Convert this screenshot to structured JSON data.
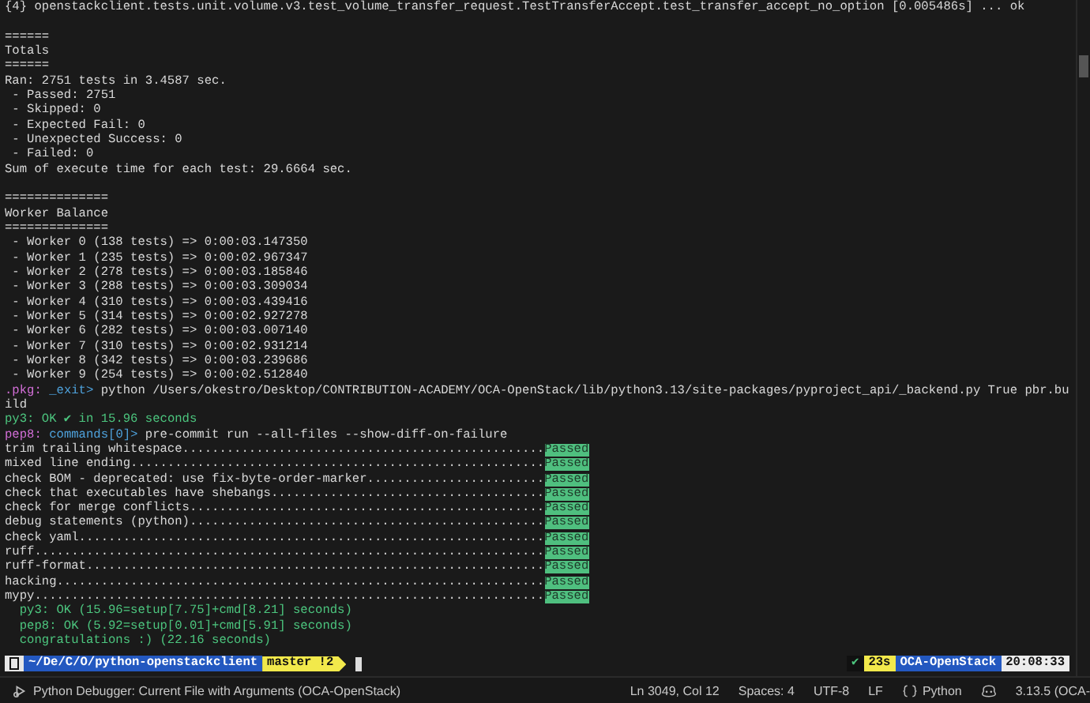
{
  "terminal": {
    "blocks": [
      [
        {
          "segments": [
            {
              "text": "{4} openstackclient.tests.unit.volume.v3.test_volume_transfer_request.TestTransferAccept.test_transfer_accept_no_option [0.005486s] ... ok",
              "kind": "plain"
            }
          ]
        }
      ],
      [
        {
          "segments": [
            {
              "text": "======",
              "kind": "plain"
            }
          ]
        },
        {
          "segments": [
            {
              "text": "Totals",
              "kind": "plain"
            }
          ]
        },
        {
          "segments": [
            {
              "text": "======",
              "kind": "plain"
            }
          ]
        },
        {
          "segments": [
            {
              "text": "Ran: 2751 tests in 3.4587 sec.",
              "kind": "plain"
            }
          ]
        },
        {
          "segments": [
            {
              "text": " - Passed: 2751",
              "kind": "plain"
            }
          ]
        },
        {
          "segments": [
            {
              "text": " - Skipped: 0",
              "kind": "plain"
            }
          ]
        },
        {
          "segments": [
            {
              "text": " - Expected Fail: 0",
              "kind": "plain"
            }
          ]
        },
        {
          "segments": [
            {
              "text": " - Unexpected Success: 0",
              "kind": "plain"
            }
          ]
        },
        {
          "segments": [
            {
              "text": " - Failed: 0",
              "kind": "plain"
            }
          ]
        },
        {
          "segments": [
            {
              "text": "Sum of execute time for each test: 29.6664 sec.",
              "kind": "plain"
            }
          ]
        }
      ],
      [
        {
          "segments": [
            {
              "text": "==============",
              "kind": "plain"
            }
          ]
        },
        {
          "segments": [
            {
              "text": "Worker Balance",
              "kind": "plain"
            }
          ]
        },
        {
          "segments": [
            {
              "text": "==============",
              "kind": "plain"
            }
          ]
        },
        {
          "segments": [
            {
              "text": " - Worker 0 (138 tests) => 0:00:03.147350",
              "kind": "plain"
            }
          ]
        },
        {
          "segments": [
            {
              "text": " - Worker 1 (235 tests) => 0:00:02.967347",
              "kind": "plain"
            }
          ]
        },
        {
          "segments": [
            {
              "text": " - Worker 2 (278 tests) => 0:00:03.185846",
              "kind": "plain"
            }
          ]
        },
        {
          "segments": [
            {
              "text": " - Worker 3 (288 tests) => 0:00:03.309034",
              "kind": "plain"
            }
          ]
        },
        {
          "segments": [
            {
              "text": " - Worker 4 (310 tests) => 0:00:03.439416",
              "kind": "plain"
            }
          ]
        },
        {
          "segments": [
            {
              "text": " - Worker 5 (314 tests) => 0:00:02.927278",
              "kind": "plain"
            }
          ]
        },
        {
          "segments": [
            {
              "text": " - Worker 6 (282 tests) => 0:00:03.007140",
              "kind": "plain"
            }
          ]
        },
        {
          "segments": [
            {
              "text": " - Worker 7 (310 tests) => 0:00:02.931214",
              "kind": "plain"
            }
          ]
        },
        {
          "segments": [
            {
              "text": " - Worker 8 (342 tests) => 0:00:03.239686",
              "kind": "plain"
            }
          ]
        },
        {
          "segments": [
            {
              "text": " - Worker 9 (254 tests) => 0:00:02.512840",
              "kind": "plain"
            }
          ]
        },
        {
          "segments": [
            {
              "text": ".pkg:",
              "kind": "magenta"
            },
            {
              "text": " _exit> ",
              "kind": "blue"
            },
            {
              "text": "python /Users/okestro/Desktop/CONTRIBUTION-ACADEMY/OCA-OpenStack/lib/python3.13/site-packages/pyproject_api/_backend.py True pbr.bu",
              "kind": "plain"
            }
          ]
        },
        {
          "segments": [
            {
              "text": "ild",
              "kind": "plain"
            }
          ]
        },
        {
          "segments": [
            {
              "text": "py3: OK ✔ in 15.96 seconds",
              "kind": "green"
            }
          ]
        },
        {
          "segments": [
            {
              "text": "pep8:",
              "kind": "magenta"
            },
            {
              "text": " commands[0]> ",
              "kind": "blue"
            },
            {
              "text": "pre-commit run --all-files --show-diff-on-failure",
              "kind": "plain"
            }
          ]
        },
        {
          "segments": [
            {
              "text": "trim trailing whitespace.................................................",
              "kind": "plain"
            },
            {
              "text": "Passed",
              "kind": "passed"
            }
          ]
        },
        {
          "segments": [
            {
              "text": "mixed line ending........................................................",
              "kind": "plain"
            },
            {
              "text": "Passed",
              "kind": "passed"
            }
          ]
        },
        {
          "segments": [
            {
              "text": "check BOM - deprecated: use fix-byte-order-marker........................",
              "kind": "plain"
            },
            {
              "text": "Passed",
              "kind": "passed"
            }
          ]
        },
        {
          "segments": [
            {
              "text": "check that executables have shebangs.....................................",
              "kind": "plain"
            },
            {
              "text": "Passed",
              "kind": "passed"
            }
          ]
        },
        {
          "segments": [
            {
              "text": "check for merge conflicts................................................",
              "kind": "plain"
            },
            {
              "text": "Passed",
              "kind": "passed"
            }
          ]
        },
        {
          "segments": [
            {
              "text": "debug statements (python)................................................",
              "kind": "plain"
            },
            {
              "text": "Passed",
              "kind": "passed"
            }
          ]
        },
        {
          "segments": [
            {
              "text": "check yaml...............................................................",
              "kind": "plain"
            },
            {
              "text": "Passed",
              "kind": "passed"
            }
          ]
        },
        {
          "segments": [
            {
              "text": "ruff.....................................................................",
              "kind": "plain"
            },
            {
              "text": "Passed",
              "kind": "passed"
            }
          ]
        },
        {
          "segments": [
            {
              "text": "ruff-format..............................................................",
              "kind": "plain"
            },
            {
              "text": "Passed",
              "kind": "passed"
            }
          ]
        },
        {
          "segments": [
            {
              "text": "hacking..................................................................",
              "kind": "plain"
            },
            {
              "text": "Passed",
              "kind": "passed"
            }
          ]
        },
        {
          "segments": [
            {
              "text": "mypy.....................................................................",
              "kind": "plain"
            },
            {
              "text": "Passed",
              "kind": "passed"
            }
          ]
        },
        {
          "segments": [
            {
              "text": "  py3: OK (15.96=setup[7.75]+cmd[8.21] seconds)",
              "kind": "green"
            }
          ]
        },
        {
          "segments": [
            {
              "text": "  pep8: OK (5.92=setup[0.01]+cmd[5.91] seconds)",
              "kind": "green"
            }
          ]
        },
        {
          "segments": [
            {
              "text": "  congratulations :) (22.16 seconds)",
              "kind": "green"
            }
          ]
        }
      ]
    ]
  },
  "prompt": {
    "left": [
      {
        "text": "~/De/C/O/python-openstackclient",
        "kind": "dir"
      },
      {
        "text": "master !2",
        "kind": "git"
      }
    ],
    "right": [
      {
        "text": "✔",
        "kind": "status"
      },
      {
        "text": "23s",
        "kind": "duration"
      },
      {
        "text": "OCA-OpenStack",
        "kind": "venv"
      },
      {
        "text": "20:08:33",
        "kind": "time"
      }
    ]
  },
  "status_bar": {
    "debug_config": "Python Debugger: Current File with Arguments (OCA-OpenStack)",
    "position": "Ln 3049, Col 12",
    "indentation": "Spaces: 4",
    "encoding": "UTF-8",
    "line_ending": "LF",
    "language": "Python",
    "interpreter": "3.13.5 (OCA-"
  }
}
